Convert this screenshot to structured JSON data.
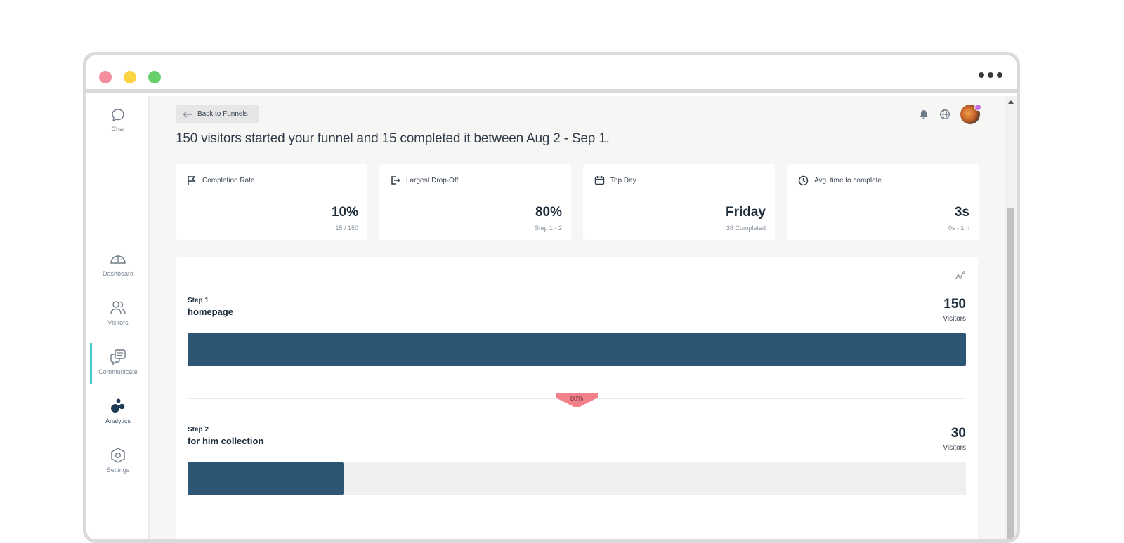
{
  "window": {
    "colors": {
      "close": "#f48fa0",
      "minimize": "#fcd343",
      "maximize": "#6ad06e"
    },
    "more_icon": "more-horizontal-icon"
  },
  "sidebar": {
    "items": [
      {
        "label": "Chat",
        "icon": "chat-bubble-icon"
      },
      {
        "label": "Dashboard",
        "icon": "gauge-icon"
      },
      {
        "label": "Visitors",
        "icon": "users-icon"
      },
      {
        "label": "Communicate",
        "icon": "messages-icon",
        "active": true
      },
      {
        "label": "Analytics",
        "icon": "analytics-dots-icon"
      },
      {
        "label": "Settings",
        "icon": "hexagon-gear-icon"
      }
    ],
    "active_color": "#3cc9c9"
  },
  "header": {
    "back_label": "Back to Funnels",
    "headline": "150 visitors started your funnel and 15 completed it between Aug 2 - Sep 1.",
    "icons": [
      "bell-icon",
      "globe-icon",
      "avatar"
    ]
  },
  "metrics": [
    {
      "label": "Completion Rate",
      "icon": "flag-icon",
      "value": "10%",
      "sub": "15 / 150"
    },
    {
      "label": "Largest Drop-Off",
      "icon": "exit-icon",
      "value": "80%",
      "sub": "Step 1 - 2"
    },
    {
      "label": "Top Day",
      "icon": "calendar-icon",
      "value": "Friday",
      "sub": "38 Completed"
    },
    {
      "label": "Avg. time to complete",
      "icon": "clock-icon",
      "value": "3s",
      "sub": "0s - 1m"
    }
  ],
  "funnel": {
    "bar_color": "#2d5574",
    "steps": [
      {
        "step": "Step 1",
        "name": "homepage",
        "count": "150",
        "unit": "Visitors",
        "fraction": 1.0
      },
      {
        "step": "Step 2",
        "name": "for him collection",
        "count": "30",
        "unit": "Visitors",
        "fraction": 0.2
      }
    ],
    "dropoff": {
      "label": "80%",
      "color": "#f4808c"
    }
  }
}
